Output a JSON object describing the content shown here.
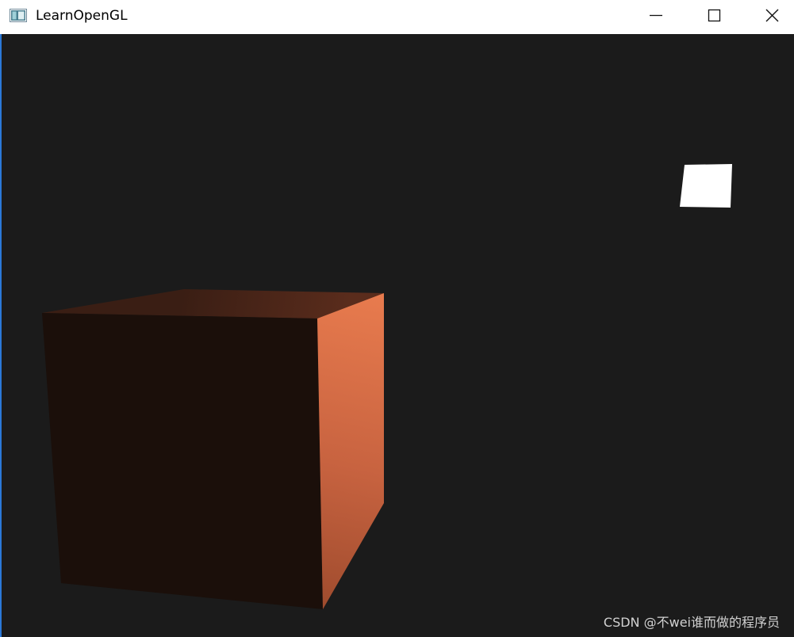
{
  "window": {
    "title": "LearnOpenGL",
    "app_icon": "opengl-window-icon",
    "buttons": {
      "minimize_icon": "minimize-icon",
      "maximize_icon": "maximize-icon",
      "close_icon": "close-icon"
    }
  },
  "scene": {
    "clear_color": "#1b1b1b",
    "object_cube_color": "#e67a4d",
    "light_cube_color": "#ffffff"
  },
  "watermark": "CSDN @不wei谁而做的程序员"
}
